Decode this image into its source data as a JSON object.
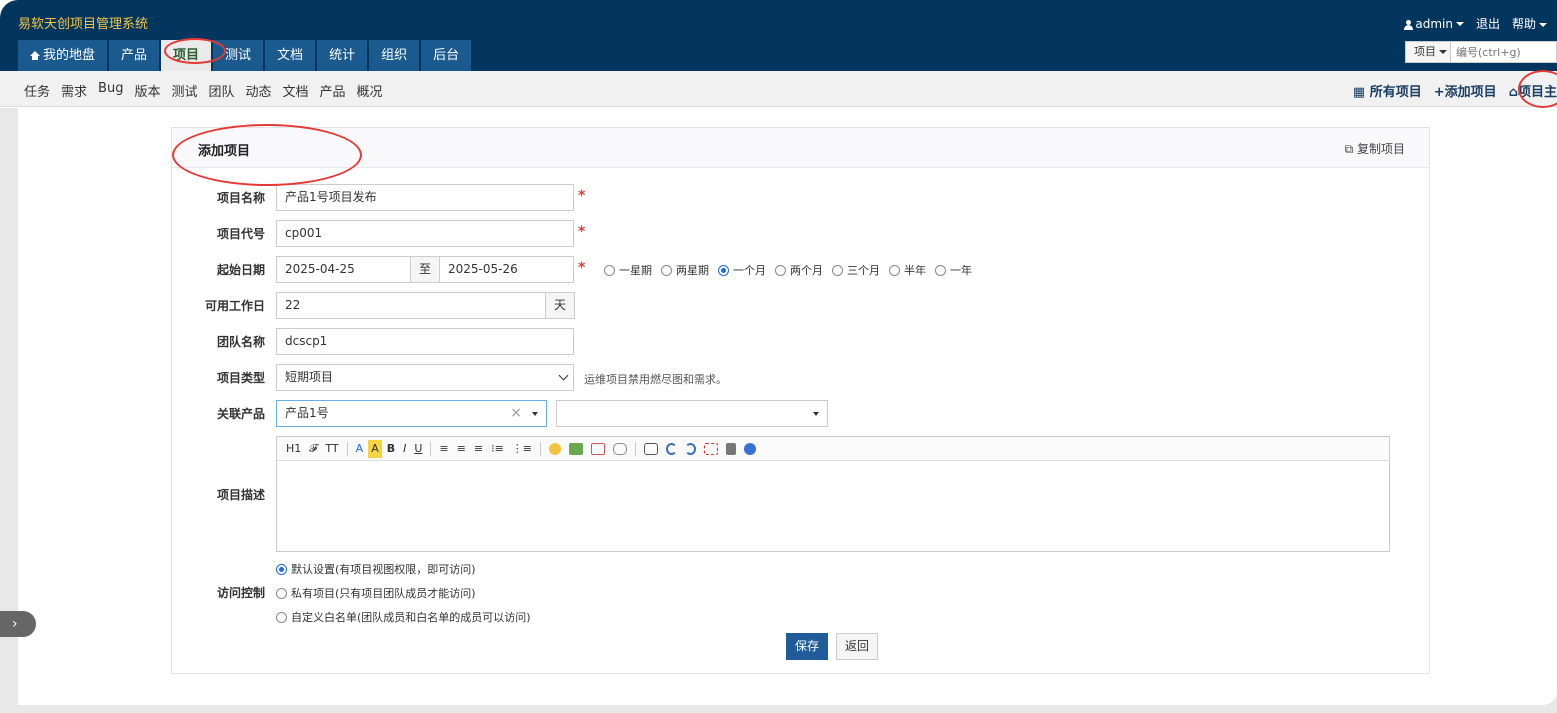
{
  "app": {
    "title": "易软天创项目管理系统"
  },
  "user_menu": {
    "user": "admin",
    "logout": "退出",
    "help": "帮助"
  },
  "main_nav": [
    {
      "label": "我的地盘"
    },
    {
      "label": "产品"
    },
    {
      "label": "项目"
    },
    {
      "label": "测试"
    },
    {
      "label": "文档"
    },
    {
      "label": "统计"
    },
    {
      "label": "组织"
    },
    {
      "label": "后台"
    }
  ],
  "search": {
    "type": "项目",
    "placeholder": "编号(ctrl+g)"
  },
  "sub_nav": {
    "items": [
      "任务",
      "需求",
      "Bug",
      "版本",
      "测试",
      "团队",
      "动态",
      "文档",
      "产品",
      "概况"
    ],
    "all_projects": "所有项目",
    "add_project": "添加项目",
    "project_home": "项目主"
  },
  "form": {
    "title": "添加项目",
    "copy_project": "复制项目",
    "name": {
      "label": "项目名称",
      "value": "产品1号项目发布"
    },
    "code": {
      "label": "项目代号",
      "value": "cp001"
    },
    "dates": {
      "label": "起始日期",
      "start": "2025-04-25",
      "to": "至",
      "end": "2025-05-26",
      "options": [
        "一星期",
        "两星期",
        "一个月",
        "两个月",
        "三个月",
        "半年",
        "一年"
      ],
      "selected": "一个月"
    },
    "workdays": {
      "label": "可用工作日",
      "value": "22",
      "unit": "天"
    },
    "team": {
      "label": "团队名称",
      "value": "dcscp1"
    },
    "type": {
      "label": "项目类型",
      "value": "短期项目",
      "hint": "运维项目禁用燃尽图和需求。"
    },
    "products": {
      "label": "关联产品",
      "product": "产品1号",
      "clear": "×",
      "second": ""
    },
    "description": {
      "label": "项目描述",
      "toolbar": [
        "H1",
        "𝓕",
        "TT",
        "A",
        "A",
        "B",
        "I",
        "U"
      ]
    },
    "acl": {
      "label": "访问控制",
      "options": [
        "默认设置(有项目视图权限，即可访问)",
        "私有项目(只有项目团队成员才能访问)",
        "自定义白名单(团队成员和白名单的成员可以访问)"
      ],
      "selected_index": 0
    },
    "save": "保存",
    "back": "返回"
  },
  "colors": {
    "header": "#03365f",
    "nav_tab": "#1a5a8f",
    "primary_button": "#1f5c99",
    "required": "#d43f3a",
    "annotation": "#e53935"
  }
}
